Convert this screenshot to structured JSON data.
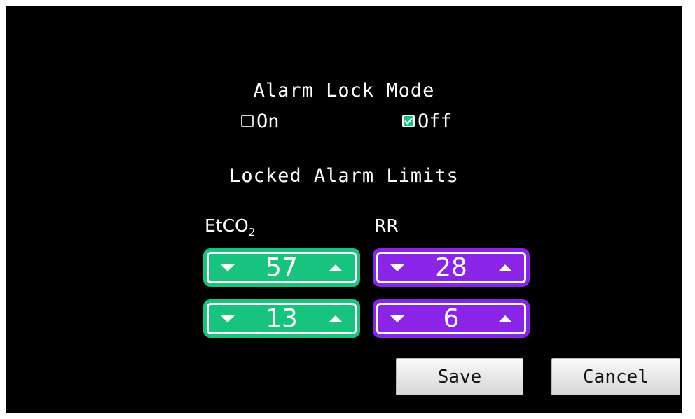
{
  "alarm_lock": {
    "title": "Alarm Lock Mode",
    "on_label": "On",
    "off_label": "Off",
    "on_checked": false,
    "off_checked": true
  },
  "limits": {
    "title": "Locked Alarm Limits",
    "etco2": {
      "label_main": "EtCO",
      "label_sub": "2",
      "high": "57",
      "low": "13",
      "color": "#18c37e"
    },
    "rr": {
      "label": "RR",
      "high": "28",
      "low": "6",
      "color": "#8a24e6"
    }
  },
  "buttons": {
    "save": "Save",
    "cancel": "Cancel"
  }
}
